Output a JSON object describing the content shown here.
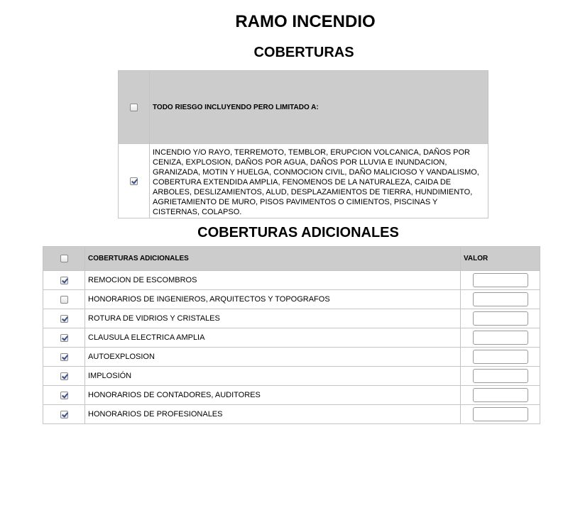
{
  "page": {
    "title": "RAMO INCENDIO",
    "coverage_title": "COBERTURAS",
    "additional_title": "COBERTURAS ADICIONALES"
  },
  "coverage": {
    "header_checked": false,
    "header_text": "TODO RIESGO INCLUYENDO PERO LIMITADO A:",
    "body_checked": true,
    "body_text": "INCENDIO Y/O RAYO, TERREMOTO, TEMBLOR, ERUPCION VOLCANICA, DAÑOS POR CENIZA, EXPLOSION, DAÑOS POR AGUA, DAÑOS POR LLUVIA E INUNDACION, GRANIZADA, MOTIN Y HUELGA, CONMOCION CIVIL, DAÑO MALICIOSO Y VANDALISMO, COBERTURA EXTENDIDA AMPLIA, FENOMENOS DE LA NATURALEZA, CAIDA DE ARBOLES, DESLIZAMIENTOS, ALUD, DESPLAZAMIENTOS DE TIERRA, HUNDIMIENTO, AGRIETAMIENTO DE MURO, PISOS PAVIMENTOS O CIMIENTOS, PISCINAS Y CISTERNAS, COLAPSO."
  },
  "additional": {
    "header_checked": false,
    "col_label": "COBERTURAS ADICIONALES",
    "col_value": "VALOR",
    "rows": [
      {
        "label": "REMOCION DE ESCOMBROS",
        "checked": true,
        "value": ""
      },
      {
        "label": "HONORARIOS DE INGENIEROS, ARQUITECTOS Y TOPOGRAFOS",
        "checked": false,
        "value": ""
      },
      {
        "label": "ROTURA DE VIDRIOS Y CRISTALES",
        "checked": true,
        "value": ""
      },
      {
        "label": "CLAUSULA ELECTRICA AMPLIA",
        "checked": true,
        "value": ""
      },
      {
        "label": "AUTOEXPLOSION",
        "checked": true,
        "value": ""
      },
      {
        "label": "IMPLOSIÓN",
        "checked": true,
        "value": ""
      },
      {
        "label": "HONORARIOS DE CONTADORES, AUDITORES",
        "checked": true,
        "value": ""
      },
      {
        "label": "HONORARIOS DE PROFESIONALES",
        "checked": true,
        "value": ""
      }
    ]
  }
}
